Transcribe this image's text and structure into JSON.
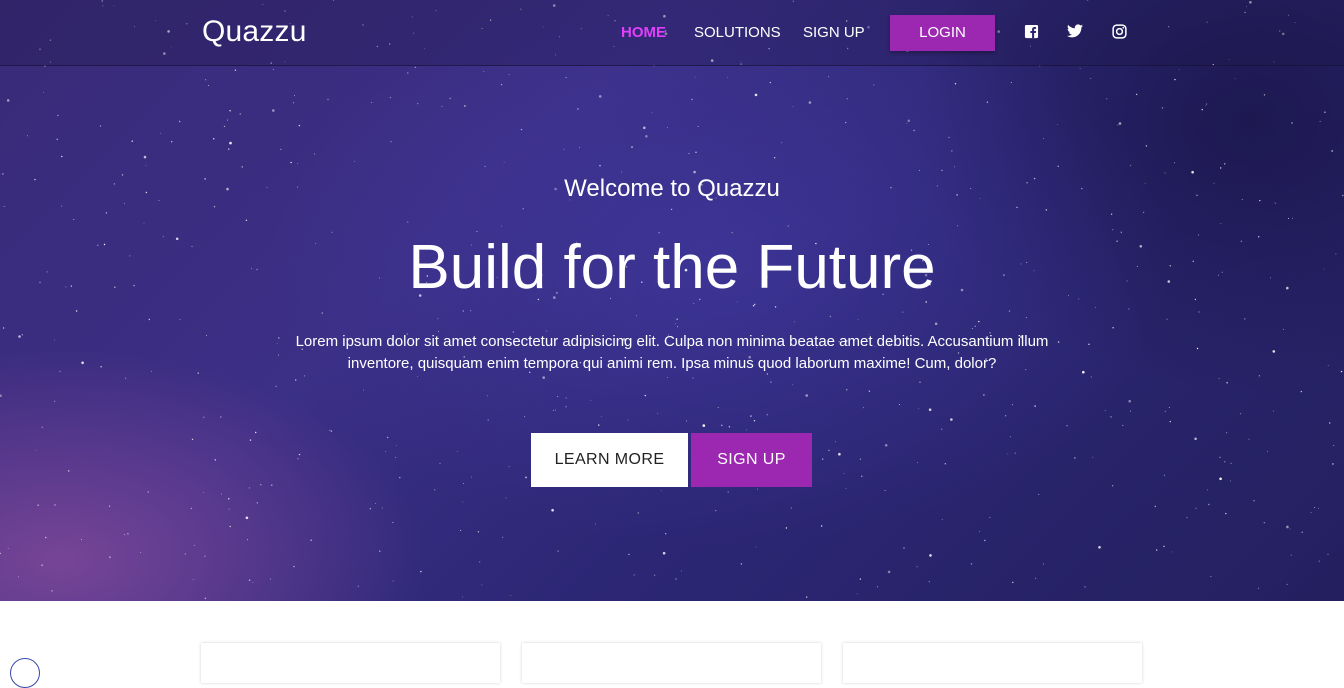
{
  "navbar": {
    "brand": "Quazzu",
    "links": [
      {
        "label": "HOME",
        "active": true
      },
      {
        "label": "SOLUTIONS",
        "active": false
      },
      {
        "label": "SIGN UP",
        "active": false
      }
    ],
    "login_label": "LOGIN",
    "social": [
      "facebook-icon",
      "twitter-icon",
      "instagram-icon"
    ]
  },
  "hero": {
    "welcome": "Welcome to Quazzu",
    "headline": "Build for the Future",
    "lead": "Lorem ipsum dolor sit amet consectetur adipisicing elit. Culpa non minima beatae amet debitis. Accusantium illum inventore, quisquam enim tempora qui animi rem. Ipsa minus quod laborum maxime! Cum, dolor?",
    "learn_more_label": "LEARN MORE",
    "sign_up_label": "SIGN UP"
  },
  "colors": {
    "accent": "#9c27b0",
    "active_link": "#e040fb",
    "hero_dark": "#24205f",
    "hero_purple": "#3a2a78"
  }
}
